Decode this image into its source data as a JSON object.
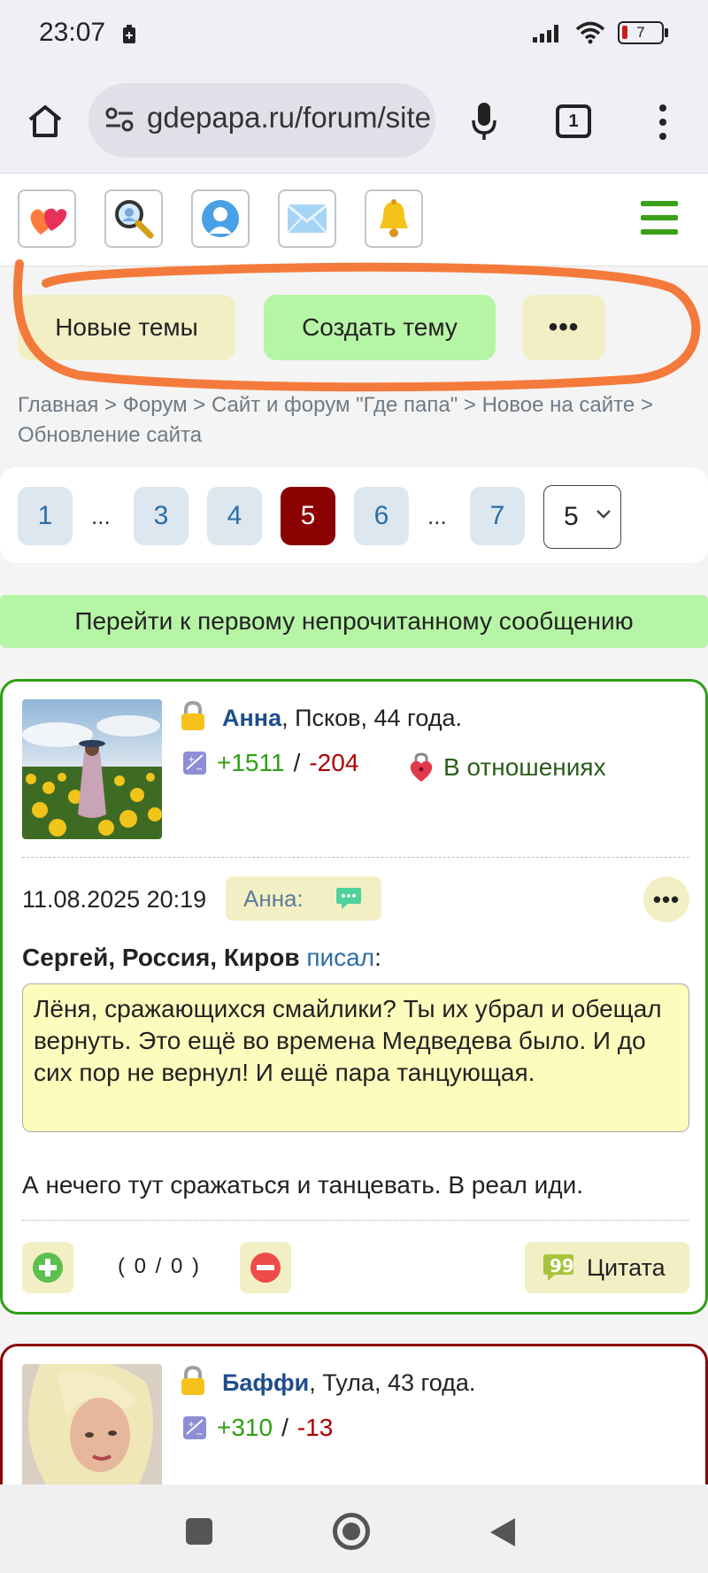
{
  "status_bar": {
    "time": "23:07",
    "battery_level": "7",
    "icons": [
      "battery-saver-icon",
      "signal-icon",
      "wifi-icon",
      "battery-icon"
    ]
  },
  "browser": {
    "url": "gdepapa.ru/forum/site",
    "tab_count": "1",
    "icons": [
      "home-icon",
      "site-settings-icon",
      "mic-icon",
      "tabs-icon",
      "more-vert-icon"
    ]
  },
  "toolbar": {
    "icons": [
      "hearts-icon",
      "search-icon",
      "profile-icon",
      "mail-icon",
      "bell-icon",
      "hamburger-menu-icon"
    ],
    "accent_color": "#3aa017"
  },
  "actions": {
    "new_topics": "Новые темы",
    "create_topic": "Создать тему",
    "more": "•••"
  },
  "breadcrumb": {
    "text": "Главная > Форум > Сайт и форум \"Где папа\" > Новое на сайте > Обновление сайта"
  },
  "pagination": {
    "pages": [
      "1",
      "3",
      "4",
      "5",
      "6",
      "7"
    ],
    "ellipsis": "...",
    "current": "5",
    "select_value": "5",
    "active_color": "#8b0000"
  },
  "unread_button": "Перейти к первому непрочитанному сообщению",
  "posts": [
    {
      "author": "Анна",
      "location": ", Псков, 44 года.",
      "rating_plus": "+1511",
      "rating_separator": "/",
      "rating_minus": "-204",
      "relationship": "В отношениях",
      "date": "11.08.2025 20:19",
      "to_label": "Анна:",
      "menu": "•••",
      "quote_author": "Сергей, Россия, Киров",
      "quote_wrote": "писал",
      "quote_colon": ":",
      "quote_text": "Лёня, сражающихся смайлики? Ты их убрал и обещал вернуть. Это ещё во времена Медведева было. И до сих пор не вернул! И ещё пара танцующая.",
      "body": "А нечего тут сражаться и танцевать. В реал иди.",
      "votes": "( 0 / 0 )",
      "quote_button": "Цитата",
      "border_color": "#2ea012"
    },
    {
      "author": "Баффи",
      "location": ", Тула, 43 года.",
      "rating_plus": "+310",
      "rating_separator": "/",
      "rating_minus": "-13",
      "border_color": "#8b0000"
    }
  ]
}
